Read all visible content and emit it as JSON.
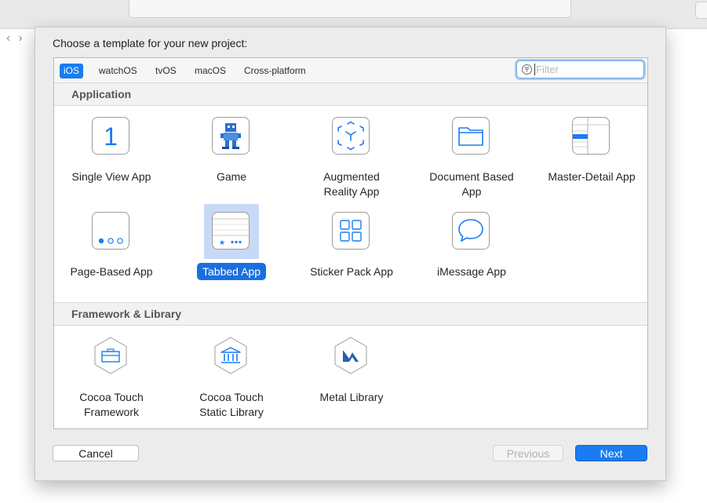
{
  "background": {
    "back_glyph": "‹",
    "forward_glyph": "›"
  },
  "dialog": {
    "title": "Choose a template for your new project:",
    "tabs": [
      {
        "label": "iOS",
        "active": true
      },
      {
        "label": "watchOS",
        "active": false
      },
      {
        "label": "tvOS",
        "active": false
      },
      {
        "label": "macOS",
        "active": false
      },
      {
        "label": "Cross-platform",
        "active": false
      }
    ],
    "filter": {
      "placeholder": "Filter",
      "value": "",
      "icon": "filter-icon"
    },
    "sections": [
      {
        "label": "Application",
        "items": [
          {
            "label": "Single View App",
            "icon": "single-view-icon"
          },
          {
            "label": "Game",
            "icon": "game-icon"
          },
          {
            "label": "Augmented Reality App",
            "icon": "augmented-reality-icon"
          },
          {
            "label": "Document Based App",
            "icon": "folder-icon"
          },
          {
            "label": "Master-Detail App",
            "icon": "master-detail-icon"
          },
          {
            "label": "Page-Based App",
            "icon": "page-dots-icon"
          },
          {
            "label": "Tabbed App",
            "icon": "tab-bar-icon",
            "selected": true
          },
          {
            "label": "Sticker Pack App",
            "icon": "sticker-grid-icon"
          },
          {
            "label": "iMessage App",
            "icon": "speech-bubble-icon"
          }
        ]
      },
      {
        "label": "Framework & Library",
        "items": [
          {
            "label": "Cocoa Touch Framework",
            "icon": "framework-toolbox-icon"
          },
          {
            "label": "Cocoa Touch Static Library",
            "icon": "library-building-icon"
          },
          {
            "label": "Metal Library",
            "icon": "metal-icon"
          }
        ]
      }
    ],
    "buttons": {
      "cancel": "Cancel",
      "previous": "Previous",
      "next": "Next"
    },
    "colors": {
      "accent": "#1a7cf0",
      "selection": "#c7d9f6"
    }
  }
}
